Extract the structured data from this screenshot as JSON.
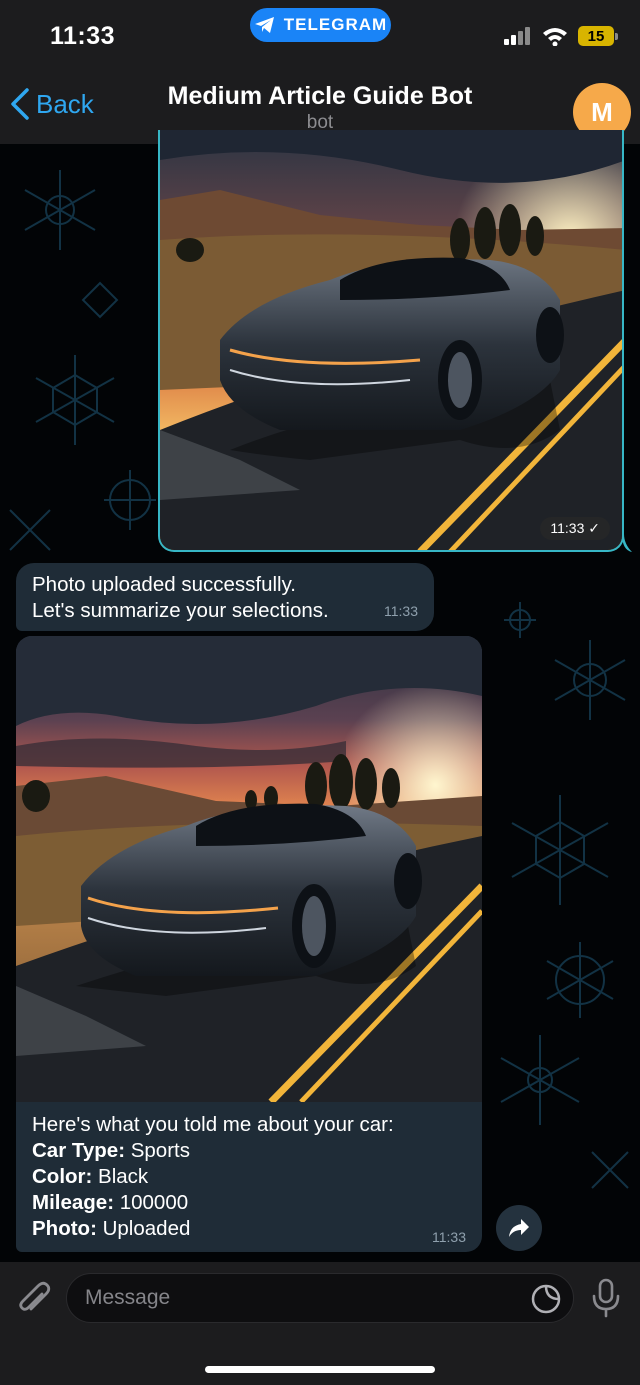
{
  "status_bar": {
    "time": "11:33",
    "app_pill": "TELEGRAM",
    "battery": "15"
  },
  "nav": {
    "back_label": "Back",
    "title": "Medium Article Guide Bot",
    "subtitle": "bot",
    "avatar_letter": "M"
  },
  "messages": {
    "photo_out": {
      "time": "11:33"
    },
    "text_in": {
      "line1": "Photo uploaded successfully.",
      "line2": "Let's summarize your selections.",
      "time": "11:33"
    },
    "photo_in": {
      "time": "11:33",
      "caption_intro": "Here's what you told me about your car:",
      "fields": [
        {
          "label": "Car Type:",
          "value": " Sports"
        },
        {
          "label": "Color:",
          "value": " Black"
        },
        {
          "label": "Mileage:",
          "value": " 100000"
        },
        {
          "label": "Photo:",
          "value": " Uploaded"
        }
      ]
    }
  },
  "input": {
    "placeholder": "Message"
  },
  "colors": {
    "accent": "#2fa7f0",
    "telegram_blue": "#1a84f7",
    "avatar": "#f6a94a",
    "bubble_in": "#1f2c37",
    "outgoing_border": "#37b7c6"
  }
}
